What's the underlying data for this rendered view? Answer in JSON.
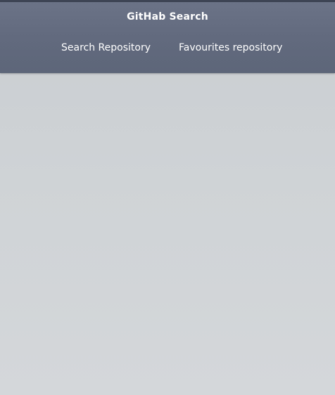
{
  "header": {
    "title": "GitHab Search",
    "tabs": [
      {
        "label": "Search Repository"
      },
      {
        "label": "Favourites repository"
      }
    ]
  },
  "colors": {
    "header_bg": "#626a7e",
    "content_bg": "#d1d5d8",
    "text": "#ffffff"
  }
}
